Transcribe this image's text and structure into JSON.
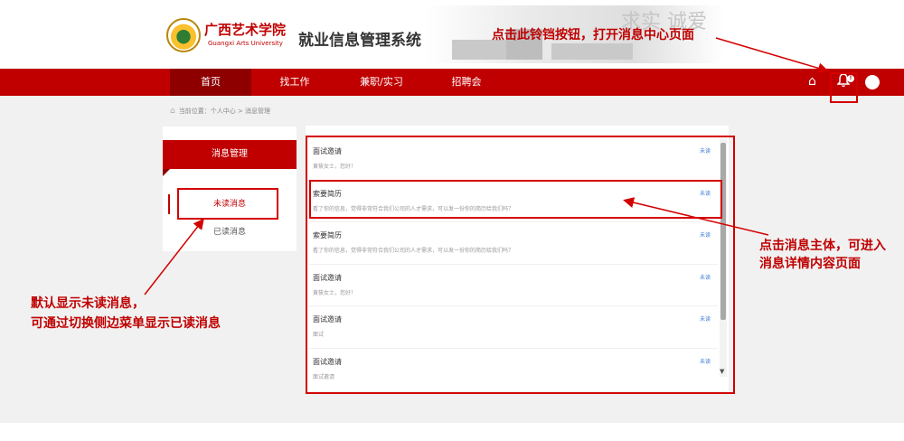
{
  "header": {
    "school_name": "广西艺术学院",
    "school_name_en": "Guangxi Arts University",
    "system_title": "就业信息管理系统",
    "background_calligraphy": "求实 诚爱"
  },
  "nav": {
    "items": [
      {
        "label": "首页",
        "active": true
      },
      {
        "label": "找工作",
        "active": false
      },
      {
        "label": "兼职/实习",
        "active": false
      },
      {
        "label": "招聘会",
        "active": false
      }
    ],
    "home_icon": "home-icon",
    "bell_icon": "bell-icon",
    "bell_badge": "!",
    "avatar_icon": "avatar-icon"
  },
  "breadcrumb": {
    "text": "当前位置：个人中心 > 消息管理"
  },
  "sidebar": {
    "title": "消息管理",
    "items": [
      {
        "label": "未读消息",
        "active": true
      },
      {
        "label": "已读消息",
        "active": false
      }
    ]
  },
  "messages": [
    {
      "title": "面试邀请",
      "body": "黄筱女士，您好！",
      "status": "未读"
    },
    {
      "title": "索要简历",
      "body": "看了你的信息，觉得非常符合我们公司的人才需求，可以发一份你的简历给我们吗？",
      "status": "未读"
    },
    {
      "title": "索要简历",
      "body": "看了你的信息，觉得非常符合我们公司的人才需求，可以发一份你的简历给我们吗？",
      "status": "未读"
    },
    {
      "title": "面试邀请",
      "body": "黄筱女士，您好！",
      "status": "未读"
    },
    {
      "title": "面试邀请",
      "body": "面试",
      "status": "未读"
    },
    {
      "title": "面试邀请",
      "body": "面试邀请",
      "status": "未读"
    }
  ],
  "annotations": {
    "top": "点击此铃铛按钮，打开消息中心页面",
    "right_line1": "点击消息主体，可进入",
    "right_line2": "消息详情内容页面",
    "left_line1": "默认显示未读消息，",
    "left_line2": "可通过切换侧边菜单显示已读消息"
  },
  "colors": {
    "brand_red": "#c00000",
    "annotation_red": "#d40000",
    "status_blue": "#3a7bd5"
  }
}
